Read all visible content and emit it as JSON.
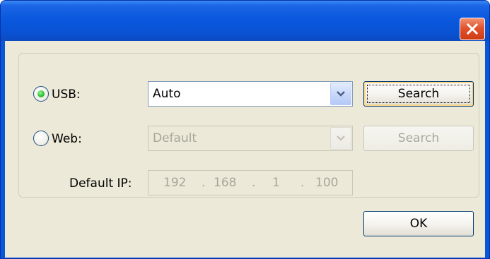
{
  "titlebar": {
    "title": ""
  },
  "connection": {
    "usb": {
      "label": "USB:",
      "selected": true,
      "combo_value": "Auto",
      "search_label": "Search"
    },
    "web": {
      "label": "Web:",
      "selected": false,
      "combo_value": "Default",
      "search_label": "Search"
    },
    "default_ip": {
      "label": "Default IP:",
      "octets": [
        "192",
        "168",
        "1",
        "100"
      ],
      "separator": "."
    }
  },
  "footer": {
    "ok_label": "OK"
  },
  "icons": {
    "close": "close-icon",
    "dropdown": "chevron-down-icon"
  },
  "colors": {
    "titlebar": "#0a58dd",
    "client": "#ece9d8",
    "close": "#e2542d",
    "radio_dot": "#38c838"
  }
}
